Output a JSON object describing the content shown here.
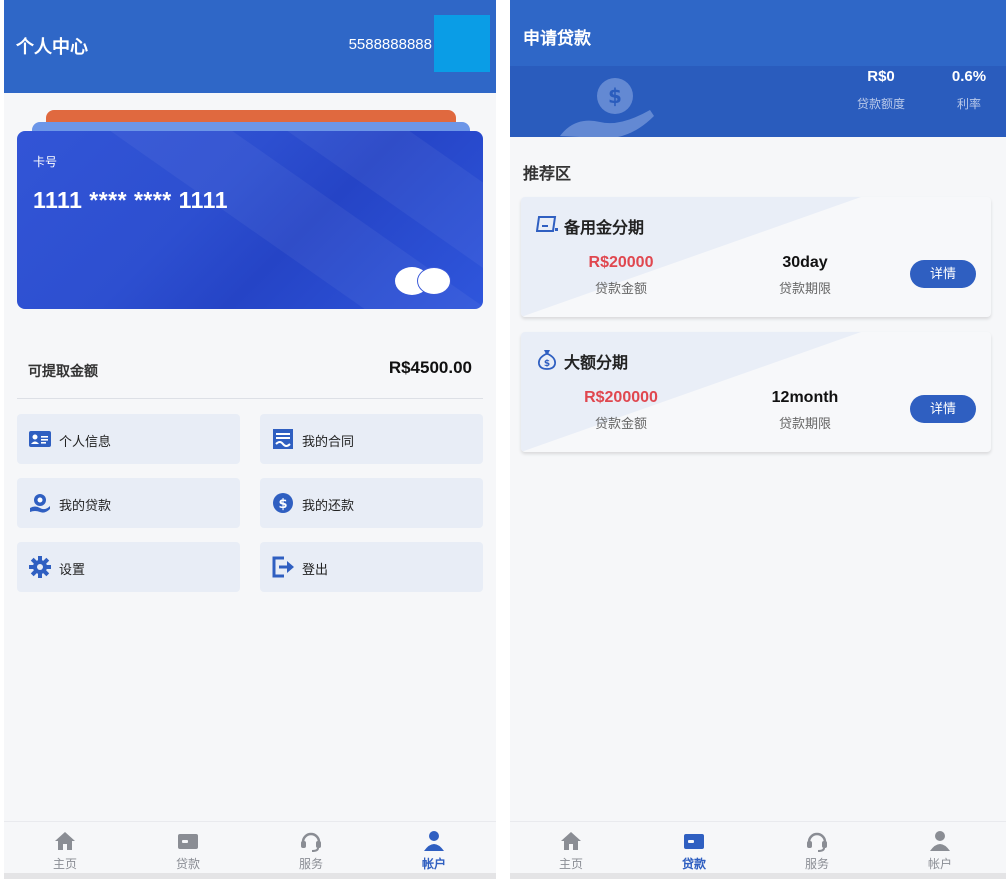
{
  "account_screen": {
    "header": {
      "title": "个人中心",
      "phone": "5588888888"
    },
    "card": {
      "label": "卡号",
      "number": "1111 **** **** 1111"
    },
    "balance": {
      "label": "可提取金额",
      "amount": "R$4500.00"
    },
    "menu": [
      {
        "label": "个人信息",
        "icon": "id-card-icon"
      },
      {
        "label": "我的合同",
        "icon": "contract-icon"
      },
      {
        "label": "我的贷款",
        "icon": "loan-hand-icon"
      },
      {
        "label": "我的还款",
        "icon": "dollar-coin-icon"
      },
      {
        "label": "设置",
        "icon": "gear-icon"
      },
      {
        "label": "登出",
        "icon": "logout-icon"
      }
    ],
    "tabbar": [
      {
        "label": "主页",
        "icon": "home-icon",
        "active": false
      },
      {
        "label": "贷款",
        "icon": "wallet-icon",
        "active": false
      },
      {
        "label": "服务",
        "icon": "headset-icon",
        "active": false
      },
      {
        "label": "帐户",
        "icon": "user-icon",
        "active": true
      }
    ]
  },
  "loan_screen": {
    "header": {
      "title": "申请贷款",
      "amount_value": "R$0",
      "amount_label": "贷款额度",
      "rate_value": "0.6%",
      "rate_label": "利率"
    },
    "section_title": "推荐区",
    "products": [
      {
        "name": "备用金分期",
        "icon": "ticket-icon",
        "amount": "R$20000",
        "amount_label": "贷款金额",
        "term": "30day",
        "term_label": "贷款期限",
        "button": "详情"
      },
      {
        "name": "大额分期",
        "icon": "money-bag-icon",
        "amount": "R$200000",
        "amount_label": "贷款金额",
        "term": "12month",
        "term_label": "贷款期限",
        "button": "详情"
      }
    ],
    "tabbar": [
      {
        "label": "主页",
        "icon": "home-icon",
        "active": false
      },
      {
        "label": "贷款",
        "icon": "wallet-icon",
        "active": true
      },
      {
        "label": "服务",
        "icon": "headset-icon",
        "active": false
      },
      {
        "label": "帐户",
        "icon": "user-icon",
        "active": false
      }
    ]
  },
  "colors": {
    "primary": "#2f67c7",
    "accent": "#2f5fc1",
    "amount_red": "#e0474f",
    "avatar_blue": "#0a9de6"
  }
}
